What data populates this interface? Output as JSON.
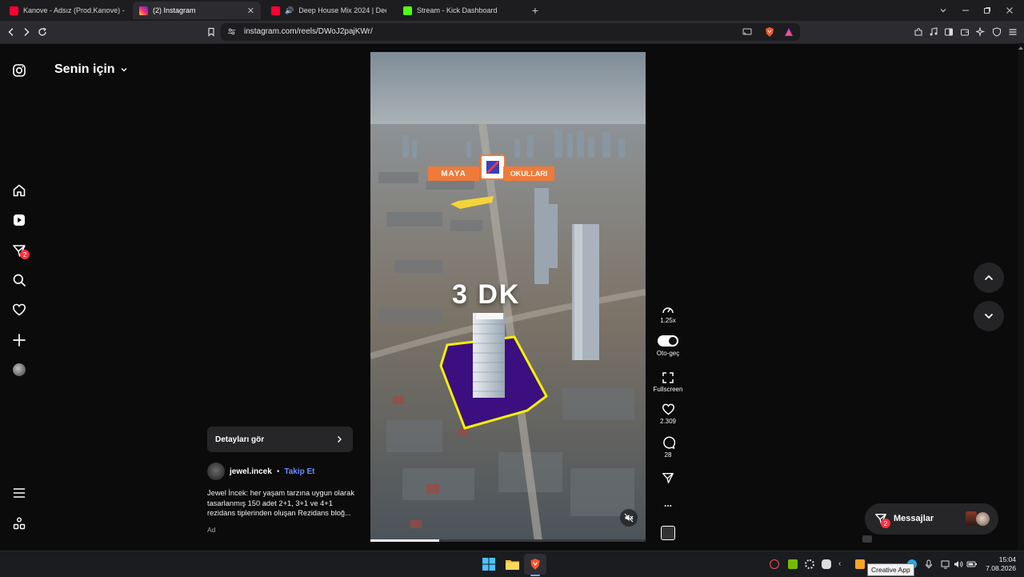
{
  "browser": {
    "tabs": [
      {
        "title": "Kanove - Adsız (Prod.Kanove) - YouTube",
        "favicon": "youtube-icon",
        "active": false
      },
      {
        "title": "(2) Instagram",
        "favicon": "instagram-icon",
        "active": true
      },
      {
        "title": "Deep House Mix 2024 | Deep Ho",
        "favicon": "youtube-icon",
        "active": false
      },
      {
        "title": "Stream - Kick Dashboard",
        "favicon": "kick-icon",
        "active": false
      }
    ],
    "url": "instagram.com/reels/DWoJ2pajKWr/"
  },
  "sidebar": {
    "feed_title": "Senin için",
    "notification_count": "2"
  },
  "reel": {
    "overlay": {
      "school_left": "MAYA",
      "school_right": "OKULLARI",
      "distance": "3 DK"
    },
    "progress": 0.25,
    "details_label": "Detayları gör",
    "author": "jewel.incek",
    "separator": "•",
    "follow_label": "Takip Et",
    "caption": "Jewel İncek: her yaşam tarzına uygun olarak tasarlanmış 150 adet 2+1, 3+1 ve 4+1 rezidans tiplerinden oluşan Rezidans bloğ...",
    "ad_label": "Ad",
    "actions": {
      "speed": "1.25x",
      "autoplay": "Oto-geç",
      "fullscreen": "Fullscreen",
      "likes": "2.309",
      "comments": "28",
      "more": "..."
    }
  },
  "messages": {
    "label": "Messajlar",
    "badge": "2"
  },
  "taskbar": {
    "time": "15:04",
    "date": "7.08.2026",
    "tooltip": "Creative App"
  },
  "colors": {
    "accent_link": "#6a8dff",
    "badge": "#ff3040",
    "overlay_orange": "#f07a3a",
    "building_outline": "#f4f000",
    "lot_fill": "#3b0f80"
  }
}
